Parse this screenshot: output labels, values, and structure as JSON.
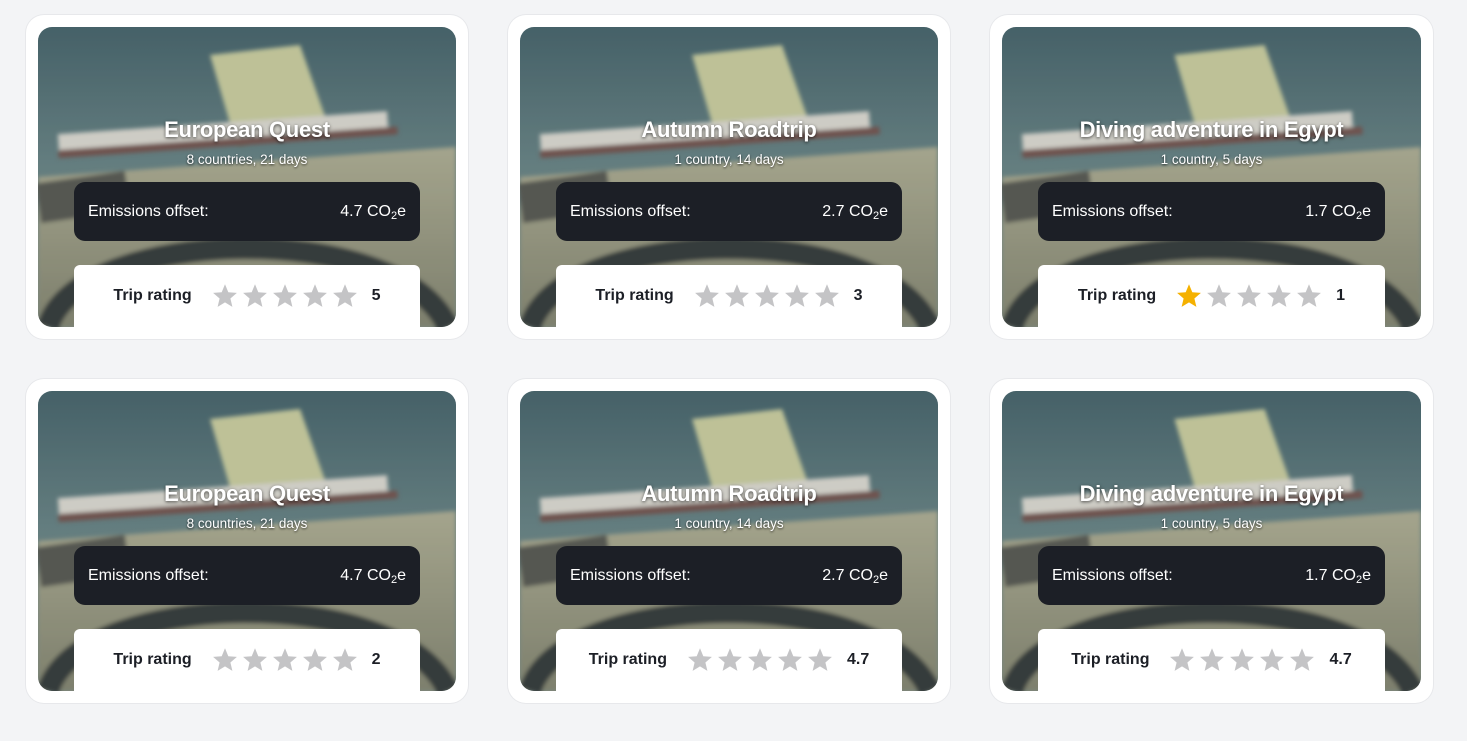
{
  "colors": {
    "star_filled": "#f5b100",
    "star_empty": "#c4c4c6",
    "emissions_bg": "#1c1f26"
  },
  "cards": [
    {
      "title": "European Quest",
      "subtitle": "8 countries, 21 days",
      "emissions_label": "Emissions offset:",
      "emissions_value": "4.7 CO",
      "emissions_sub": "2",
      "emissions_unit": "e",
      "rating_label": "Trip rating",
      "rating_value": "5",
      "stars_filled": 0
    },
    {
      "title": "Autumn Roadtrip",
      "subtitle": "1 country, 14 days",
      "emissions_label": "Emissions offset:",
      "emissions_value": "2.7 CO",
      "emissions_sub": "2",
      "emissions_unit": "e",
      "rating_label": "Trip rating",
      "rating_value": "3",
      "stars_filled": 0
    },
    {
      "title": "Diving adventure in Egypt",
      "subtitle": "1 country, 5 days",
      "emissions_label": "Emissions offset:",
      "emissions_value": "1.7 CO",
      "emissions_sub": "2",
      "emissions_unit": "e",
      "rating_label": "Trip rating",
      "rating_value": "1",
      "stars_filled": 1
    },
    {
      "title": "European Quest",
      "subtitle": "8 countries, 21 days",
      "emissions_label": "Emissions offset:",
      "emissions_value": "4.7 CO",
      "emissions_sub": "2",
      "emissions_unit": "e",
      "rating_label": "Trip rating",
      "rating_value": "2",
      "stars_filled": 0
    },
    {
      "title": "Autumn Roadtrip",
      "subtitle": "1 country, 14 days",
      "emissions_label": "Emissions offset:",
      "emissions_value": "2.7 CO",
      "emissions_sub": "2",
      "emissions_unit": "e",
      "rating_label": "Trip rating",
      "rating_value": "4.7",
      "stars_filled": 0
    },
    {
      "title": "Diving adventure in Egypt",
      "subtitle": "1 country, 5 days",
      "emissions_label": "Emissions offset:",
      "emissions_value": "1.7 CO",
      "emissions_sub": "2",
      "emissions_unit": "e",
      "rating_label": "Trip rating",
      "rating_value": "4.7",
      "stars_filled": 0
    }
  ]
}
